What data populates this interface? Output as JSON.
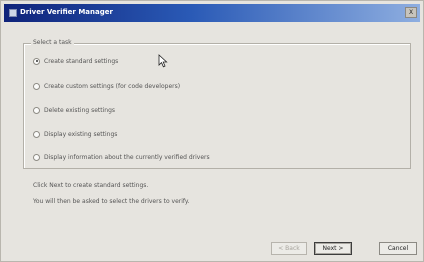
{
  "window": {
    "title": "Driver Verifier Manager",
    "close_label": "X"
  },
  "task_group": {
    "legend": "Select a task",
    "options": [
      {
        "label": "Create standard settings",
        "checked": true
      },
      {
        "label": "Create custom settings (for code developers)",
        "checked": false
      },
      {
        "label": "Delete existing settings",
        "checked": false
      },
      {
        "label": "Display existing settings",
        "checked": false
      },
      {
        "label": "Display information about the currently verified drivers",
        "checked": false
      }
    ]
  },
  "info": {
    "line1": "Click Next to create standard settings.",
    "line2": "You will then be asked to select the drivers to verify."
  },
  "buttons": {
    "back": "< Back",
    "next": "Next >",
    "cancel": "Cancel"
  }
}
